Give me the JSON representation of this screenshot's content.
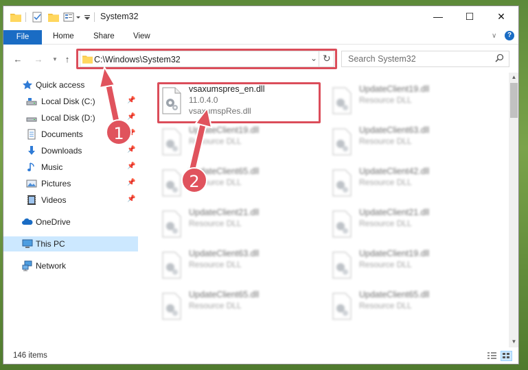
{
  "window": {
    "title": "System32",
    "controls": {
      "minimize": "—",
      "maximize": "☐",
      "close": "✕"
    }
  },
  "ribbon": {
    "tabs": [
      {
        "label": "File",
        "active": true
      },
      {
        "label": "Home"
      },
      {
        "label": "Share"
      },
      {
        "label": "View"
      }
    ]
  },
  "address": {
    "path": "C:\\Windows\\System32",
    "search_placeholder": "Search System32"
  },
  "nav_pane": {
    "quick_access": "Quick access",
    "items": [
      {
        "label": "Local Disk (C:)",
        "icon": "drive-icon",
        "pinned": true
      },
      {
        "label": "Local Disk (D:)",
        "icon": "drive-icon",
        "pinned": true
      },
      {
        "label": "Documents",
        "icon": "documents-icon",
        "pinned": true
      },
      {
        "label": "Downloads",
        "icon": "downloads-icon",
        "pinned": true
      },
      {
        "label": "Music",
        "icon": "music-icon",
        "pinned": true
      },
      {
        "label": "Pictures",
        "icon": "pictures-icon",
        "pinned": true
      },
      {
        "label": "Videos",
        "icon": "videos-icon",
        "pinned": true
      }
    ],
    "onedrive": "OneDrive",
    "this_pc": "This PC",
    "network": "Network"
  },
  "files": [
    {
      "name": "vsaxumspres_en.dll",
      "version": "11.0.4.0",
      "desc": "vsaxumspRes.dll",
      "highlighted": true
    },
    {
      "name": "UpdateClient19.dll",
      "desc": "Resource DLL"
    },
    {
      "name": "UpdateClient19.dll",
      "desc": "Resource DLL"
    },
    {
      "name": "UpdateClient63.dll",
      "desc": "Resource DLL"
    },
    {
      "name": "UpdateClient65.dll",
      "desc": "Resource DLL"
    },
    {
      "name": "UpdateClient42.dll",
      "desc": "Resource DLL"
    },
    {
      "name": "UpdateClient21.dll",
      "desc": "Resource DLL"
    },
    {
      "name": "UpdateClient21.dll",
      "desc": "Resource DLL"
    },
    {
      "name": "UpdateClient63.dll",
      "desc": "Resource DLL"
    },
    {
      "name": "UpdateClient19.dll",
      "desc": "Resource DLL"
    },
    {
      "name": "UpdateClient65.dll",
      "desc": "Resource DLL"
    },
    {
      "name": "UpdateClient65.dll",
      "desc": "Resource DLL"
    }
  ],
  "status": {
    "item_count": "146 items"
  },
  "annotations": {
    "step1": "1",
    "step2": "2",
    "highlight_color": "#db4d5a"
  },
  "colors": {
    "accent": "#1a6cc4",
    "selection": "#cce8ff"
  }
}
